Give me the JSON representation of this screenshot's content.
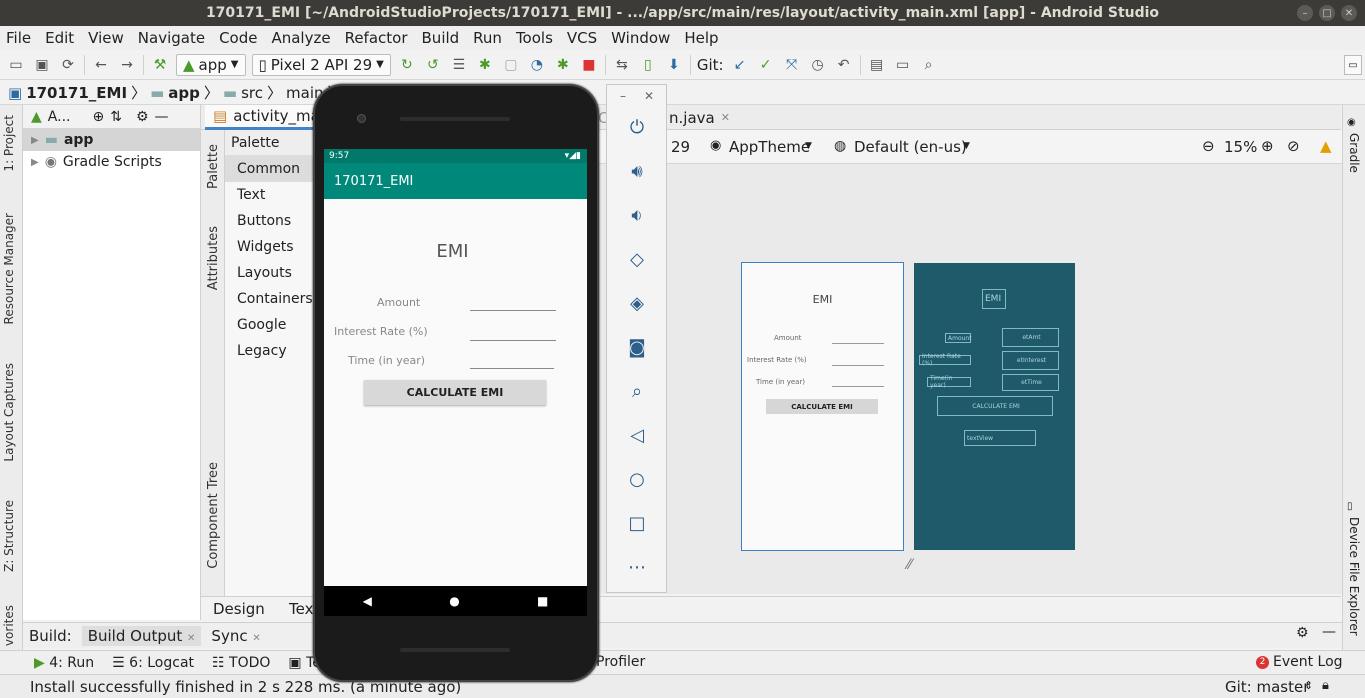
{
  "window": {
    "title": "170171_EMI [~/AndroidStudioProjects/170171_EMI] - .../app/src/main/res/layout/activity_main.xml [app] - Android Studio"
  },
  "menu": [
    "File",
    "Edit",
    "View",
    "Navigate",
    "Code",
    "Analyze",
    "Refactor",
    "Build",
    "Run",
    "Tools",
    "VCS",
    "Window",
    "Help"
  ],
  "toolbar": {
    "run_config": "app",
    "device": "Pixel 2 API 29",
    "git_label": "Git:"
  },
  "breadcrumb": {
    "project": "170171_EMI",
    "module": "app",
    "src": "src",
    "main": "main"
  },
  "left_tabs": {
    "project": "1: Project",
    "resource_manager": "Resource Manager",
    "layout_captures": "Layout Captures",
    "structure": "Z: Structure",
    "favorites": "vorites"
  },
  "project_panel": {
    "header": "A...",
    "items": [
      "app",
      "Gradle Scripts"
    ]
  },
  "editor_tabs": {
    "activity_main": "activity_mai",
    "java_tab_prefix": "Ca",
    "java_tab": "n.java"
  },
  "palette": {
    "tab": "Palette",
    "attributes_tab": "Attributes",
    "component_tree_tab": "Component Tree",
    "header": "Palette",
    "items": [
      "Common",
      "Text",
      "Buttons",
      "Widgets",
      "Layouts",
      "Containers",
      "Google",
      "Legacy"
    ]
  },
  "design_toolbar": {
    "api": "29",
    "theme": "AppTheme",
    "locale": "Default (en-us)",
    "zoom": "15%"
  },
  "design_tabs": {
    "design": "Design",
    "text": "Tex"
  },
  "right_tabs": {
    "gradle": "Gradle",
    "device_file_explorer": "Device File Explorer"
  },
  "build_bar": {
    "label": "Build:",
    "build_output": "Build Output",
    "sync": "Sync"
  },
  "bottom_tools": {
    "run": "4: Run",
    "logcat": "6: Logcat",
    "todo": "TODO",
    "terminal": "Term",
    "profiler": "Profiler",
    "event_log": "Event Log",
    "event_count": "2"
  },
  "status": {
    "message": "Install successfully finished in 2 s 228 ms. (a minute ago)",
    "git": "Git: master"
  },
  "emulator": {
    "time": "9:57",
    "app_title": "170171_EMI",
    "heading": "EMI",
    "amount_label": "Amount",
    "interest_label": "Interest Rate (%)",
    "time_label": "Time (in year)",
    "calc_button": "CALCULATE EMI"
  },
  "blueprint": {
    "heading": "EMI",
    "amount_label": "Amount",
    "interest_label": "Interest Rate (%)",
    "time_label": "Time (in year)",
    "calc_button": "CALCULATE EMI",
    "bp_heading": "EMI",
    "bp_amount": "Amount",
    "bp_interest": "Interest Rate (%)",
    "bp_time": "Time(in year)",
    "bp_et_amt": "etAmt",
    "bp_et_interest": "etInterest",
    "bp_et_time": "etTime",
    "bp_calc": "CALCULATE EMI",
    "bp_textview": "textView"
  },
  "colors": {
    "accent_teal": "#00897b",
    "blueprint": "#1f5a6b",
    "selection_blue": "#3a82c4"
  }
}
